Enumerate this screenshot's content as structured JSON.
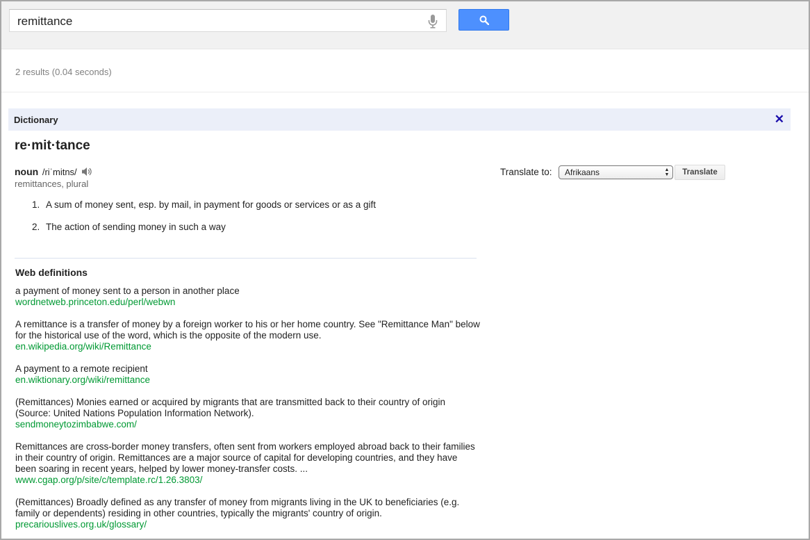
{
  "search": {
    "query": "remittance",
    "mic_icon": "microphone-icon",
    "button_icon": "magnifier-icon",
    "accent": "#4d90fe"
  },
  "stats": "2 results (0.04 seconds)",
  "dictionary": {
    "header": "Dictionary",
    "close_symbol": "✕",
    "headword": "re·mit·tance",
    "pos": "noun",
    "pronunciation": "/riˈmitns/",
    "speaker_icon": "speaker-icon",
    "plural": "remittances, plural",
    "senses": [
      {
        "num": "1.",
        "text": "A sum of money sent, esp. by mail, in payment for goods or services or as a gift"
      },
      {
        "num": "2.",
        "text": "The action of sending money in such a way"
      }
    ],
    "translate": {
      "label": "Translate to:",
      "selected": "Afrikaans",
      "button": "Translate"
    }
  },
  "web_definitions": {
    "title": "Web definitions",
    "link_color": "#009933",
    "items": [
      {
        "text": "a payment of money sent to a person in another place",
        "source": "wordnetweb.princeton.edu/perl/webwn"
      },
      {
        "text": "A remittance is a transfer of money by a foreign worker to his or her home country. See \"Remittance Man\" below for the historical use of the word, which is the opposite of the modern use.",
        "source": "en.wikipedia.org/wiki/Remittance"
      },
      {
        "text": "A payment to a remote recipient",
        "source": "en.wiktionary.org/wiki/remittance"
      },
      {
        "text": "(Remittances) Monies earned or acquired by migrants that are transmitted back to their country of origin (Source: United Nations Population Information Network).",
        "source": "sendmoneytozimbabwe.com/"
      },
      {
        "text": "Remittances are cross-border money transfers, often sent from workers employed abroad back to their families in their country of origin. Remittances are a major source of capital for developing countries, and they have been soaring in recent years, helped by lower money-transfer costs. ...",
        "source": "www.cgap.org/p/site/c/template.rc/1.26.3803/"
      },
      {
        "text": "(Remittances) Broadly defined as any transfer of money from migrants living in the UK to beneficiaries (e.g. family or dependents) residing in other countries, typically the migrants' country of origin.",
        "source": "precariouslives.org.uk/glossary/"
      }
    ]
  }
}
